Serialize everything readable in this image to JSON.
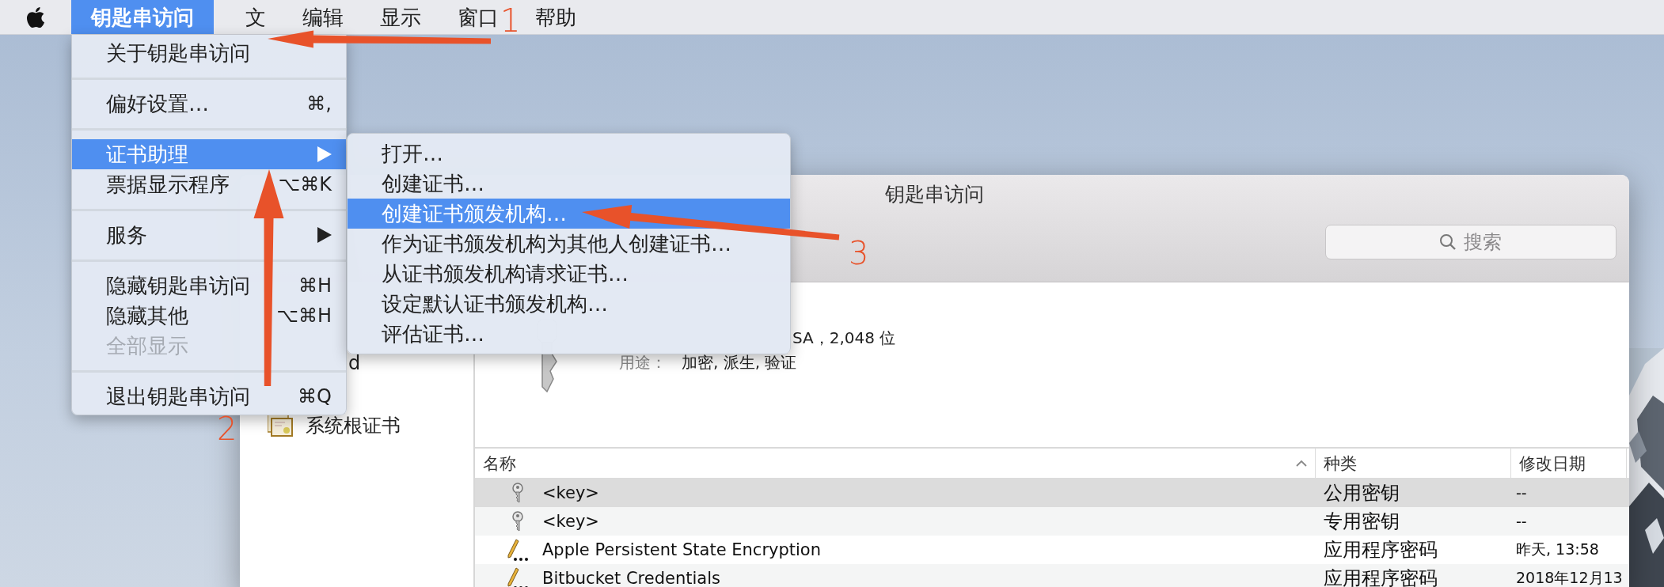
{
  "menu_bar": {
    "items": [
      {
        "label": "钥匙串访问",
        "selected": true
      },
      {
        "label": "文",
        "selected": false
      },
      {
        "label": "编辑",
        "selected": false
      },
      {
        "label": "显示",
        "selected": false
      },
      {
        "label": "窗口",
        "selected": false
      },
      {
        "label": "帮助",
        "selected": false
      }
    ]
  },
  "app_menu": {
    "items": [
      {
        "kind": "item",
        "label": "关于钥匙串访问",
        "selected": false,
        "disabled": false
      },
      {
        "kind": "separator"
      },
      {
        "kind": "item",
        "label": "偏好设置…",
        "shortcut": "⌘,",
        "selected": false,
        "disabled": false
      },
      {
        "kind": "separator"
      },
      {
        "kind": "submenu",
        "label": "证书助理",
        "selected": true,
        "disabled": false
      },
      {
        "kind": "item",
        "label": "票据显示程序",
        "shortcut": "⌥⌘K",
        "selected": false,
        "disabled": false
      },
      {
        "kind": "separator"
      },
      {
        "kind": "submenu",
        "label": "服务",
        "selected": false,
        "disabled": false
      },
      {
        "kind": "separator"
      },
      {
        "kind": "item",
        "label": "隐藏钥匙串访问",
        "shortcut": "⌘H",
        "selected": false,
        "disabled": false
      },
      {
        "kind": "item",
        "label": "隐藏其他",
        "shortcut": "⌥⌘H",
        "selected": false,
        "disabled": false
      },
      {
        "kind": "item",
        "label": "全部显示",
        "selected": false,
        "disabled": true
      },
      {
        "kind": "separator"
      },
      {
        "kind": "item",
        "label": "退出钥匙串访问",
        "shortcut": "⌘Q",
        "selected": false,
        "disabled": false
      }
    ]
  },
  "submenu": {
    "items": [
      {
        "label": "打开…",
        "selected": false
      },
      {
        "label": "创建证书…",
        "selected": false
      },
      {
        "label": "创建证书颁发机构…",
        "selected": true
      },
      {
        "label": "作为证书颁发机构为其他人创建证书…",
        "selected": false
      },
      {
        "label": "从证书颁发机构请求证书…",
        "selected": false
      },
      {
        "label": "设定默认证书颁发机构…",
        "selected": false
      },
      {
        "label": "评估证书…",
        "selected": false
      }
    ]
  },
  "window": {
    "title": "钥匙串访问",
    "search": {
      "placeholder": "搜索"
    },
    "sidebar": {
      "items": [
        {
          "kind": "plain",
          "label": "d"
        },
        {
          "kind": "certificate",
          "label": "系统根证书"
        }
      ]
    },
    "info": {
      "lines": [
        {
          "value": "SA，2,048 位"
        },
        {
          "label": "用途：",
          "value": "加密, 派生, 验证"
        }
      ]
    },
    "table": {
      "columns": [
        {
          "label": "名称",
          "sorted": true
        },
        {
          "label": "种类",
          "sorted": false
        },
        {
          "label": "修改日期",
          "sorted": false
        }
      ],
      "rows": [
        {
          "kind": "key",
          "name": "<key>",
          "type": "公用密钥",
          "date": "--",
          "selected": true
        },
        {
          "kind": "key",
          "name": "<key>",
          "type": "专用密钥",
          "date": "--",
          "selected": false
        },
        {
          "kind": "password",
          "name": "Apple Persistent State Encryption",
          "type": "应用程序密码",
          "date": "昨天, 13:58",
          "selected": false
        },
        {
          "kind": "password",
          "name": "Bitbucket Credentials",
          "type": "应用程序密码",
          "date": "2018年12月13",
          "selected": false
        }
      ]
    }
  },
  "annotations": [
    {
      "number": "1"
    },
    {
      "number": "2"
    },
    {
      "number": "3"
    }
  ]
}
